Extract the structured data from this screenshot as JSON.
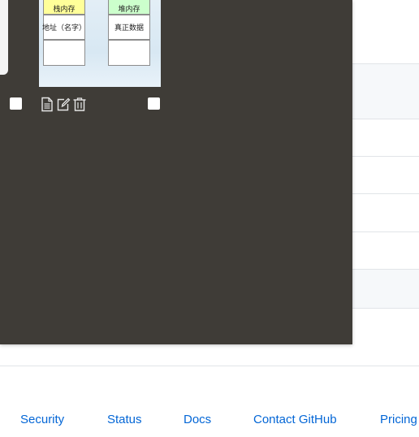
{
  "thumbnail": {
    "left_top_label": "栈内存",
    "right_top_label": "堆内存",
    "left_mid_label": "地址（名字）",
    "right_mid_label": "真正数据"
  },
  "toolbar": {
    "icons": [
      "document-icon",
      "edit-icon",
      "trash-icon"
    ]
  },
  "footer": {
    "links": [
      "Security",
      "Status",
      "Docs",
      "Contact GitHub",
      "Pricing"
    ]
  },
  "colors": {
    "panel": "#3f3c37",
    "link": "#0366d6",
    "yellow_cell": "#ffff99",
    "green_cell": "#ccffcc"
  }
}
